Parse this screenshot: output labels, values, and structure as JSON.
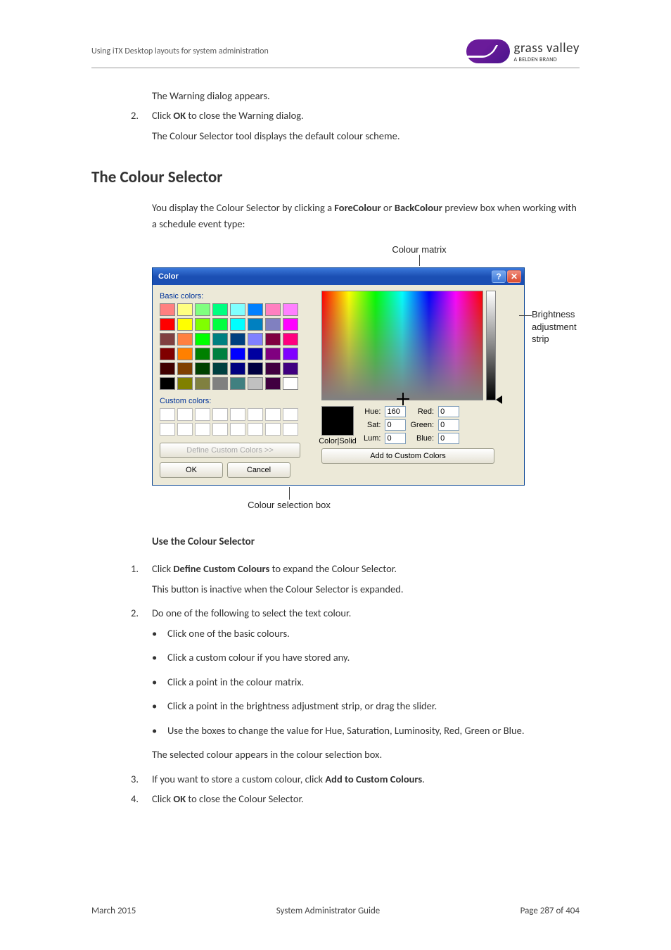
{
  "header": {
    "running_title": "Using iTX Desktop layouts for system administration",
    "brand": "grass valley",
    "brand_sub": "A BELDEN BRAND"
  },
  "intro_block": {
    "line1": "The Warning dialog appears.",
    "step2_pre": "Click ",
    "step2_bold": "OK",
    "step2_post": " to close the Warning dialog.",
    "line3": "The Colour Selector tool displays the default colour scheme."
  },
  "section_title": "The Colour Selector",
  "section_intro_pre": "You display the Colour Selector by clicking a ",
  "section_intro_b1": "ForeColour",
  "section_intro_mid": " or ",
  "section_intro_b2": "BackColour",
  "section_intro_post": " preview box when working with a schedule event type:",
  "fig": {
    "top_label": "Colour matrix",
    "right_label": "Brightness adjustment strip",
    "bottom_label": "Colour selection box"
  },
  "dialog": {
    "title": "Color",
    "basic_label": "Basic colors:",
    "custom_label": "Custom colors:",
    "define_btn": "Define Custom Colors >>",
    "ok": "OK",
    "cancel": "Cancel",
    "colorsolid": "Color|Solid",
    "hue_l": "Hue:",
    "hue_v": "160",
    "sat_l": "Sat:",
    "sat_v": "0",
    "lum_l": "Lum:",
    "lum_v": "0",
    "red_l": "Red:",
    "red_v": "0",
    "green_l": "Green:",
    "green_v": "0",
    "blue_l": "Blue:",
    "blue_v": "0",
    "add_btn": "Add to Custom Colors",
    "basic_colors": [
      "#ff8080",
      "#ffff80",
      "#80ff80",
      "#00ff80",
      "#80ffff",
      "#0080ff",
      "#ff80c0",
      "#ff80ff",
      "#ff0000",
      "#ffff00",
      "#80ff00",
      "#00ff40",
      "#00ffff",
      "#0080c0",
      "#8080c0",
      "#ff00ff",
      "#804040",
      "#ff8040",
      "#00ff00",
      "#008080",
      "#004080",
      "#8080ff",
      "#800040",
      "#ff0080",
      "#800000",
      "#ff8000",
      "#008000",
      "#008040",
      "#0000ff",
      "#0000a0",
      "#800080",
      "#8000ff",
      "#400000",
      "#804000",
      "#004000",
      "#004040",
      "#000080",
      "#000040",
      "#400040",
      "#400080",
      "#000000",
      "#808000",
      "#808040",
      "#808080",
      "#408080",
      "#c0c0c0",
      "#400040",
      "#ffffff"
    ]
  },
  "subsection_title": "Use the Colour Selector",
  "steps": {
    "s1_pre": "Click ",
    "s1_b": "Define Custom Colours",
    "s1_post": " to expand the Colour Selector.",
    "s1_note": "This button is inactive when the Colour Selector is expanded.",
    "s2": "Do one of the following to select the text colour.",
    "s2_b1": "Click one of the basic colours.",
    "s2_b2": "Click a custom colour if you have stored any.",
    "s2_b3": "Click a point in the colour matrix.",
    "s2_b4": "Click a point in the brightness adjustment strip, or drag the slider.",
    "s2_b5": "Use the boxes to change the value for Hue, Saturation, Luminosity, Red, Green or Blue.",
    "s2_note": "The selected colour appears in the colour selection box.",
    "s3_pre": "If you want to store a custom colour, click ",
    "s3_b": "Add to Custom Colours",
    "s3_post": ".",
    "s4_pre": "Click ",
    "s4_b": "OK",
    "s4_post": " to close the Colour Selector."
  },
  "footer": {
    "left": "March 2015",
    "center": "System Administrator Guide",
    "right": "Page 287 of 404"
  }
}
